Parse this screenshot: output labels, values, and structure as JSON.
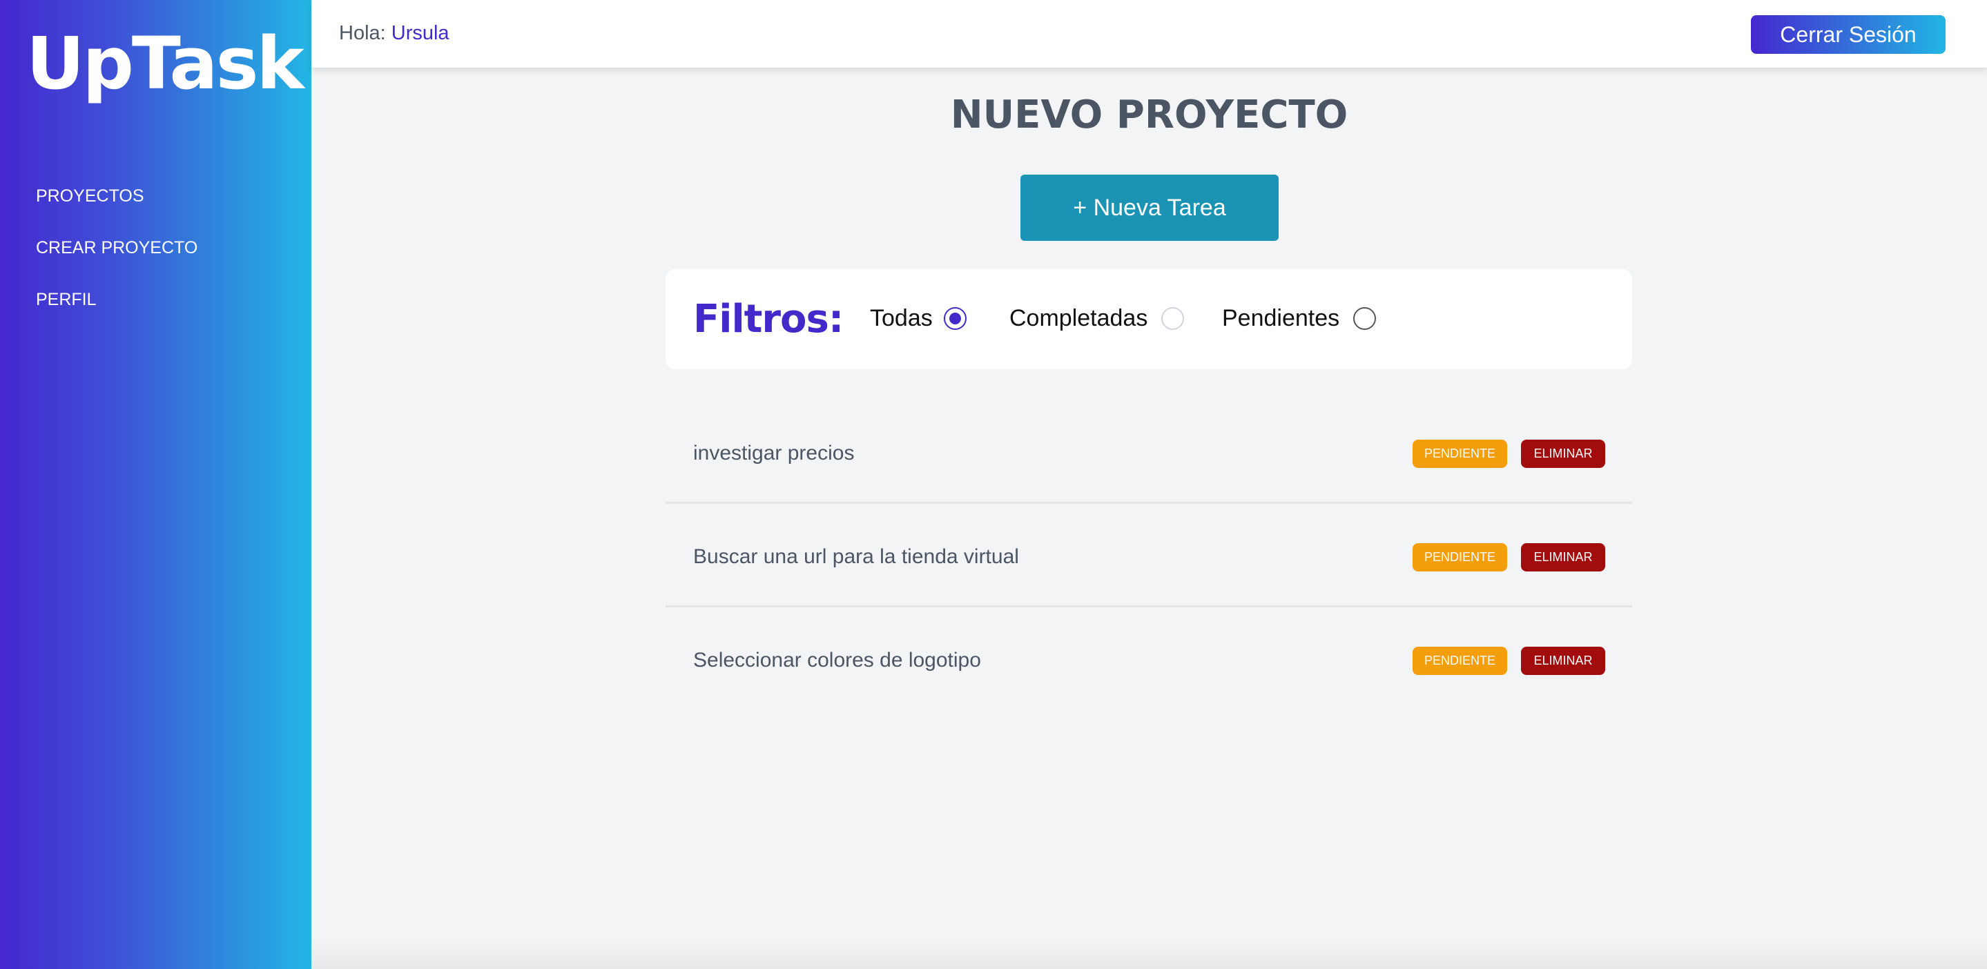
{
  "app": {
    "logo": "UpTask"
  },
  "sidebar": {
    "items": [
      {
        "label": "PROYECTOS"
      },
      {
        "label": "CREAR PROYECTO"
      },
      {
        "label": "PERFIL"
      }
    ]
  },
  "header": {
    "greeting": "Hola:",
    "user": "Ursula",
    "logout_label": "Cerrar Sesión"
  },
  "main": {
    "title": "NUEVO PROYECTO",
    "new_task_label": "+ Nueva Tarea",
    "filters": {
      "title": "Filtros:",
      "options": [
        {
          "label": "Todas",
          "selected": true
        },
        {
          "label": "Completadas",
          "selected": false
        },
        {
          "label": "Pendientes",
          "selected": false
        }
      ]
    },
    "tasks": [
      {
        "name": "investigar precios",
        "status": "PENDIENTE",
        "delete_label": "ELIMINAR"
      },
      {
        "name": "Buscar una url para la tienda virtual",
        "status": "PENDIENTE",
        "delete_label": "ELIMINAR"
      },
      {
        "name": "Seleccionar colores de logotipo",
        "status": "PENDIENTE",
        "delete_label": "ELIMINAR"
      }
    ]
  },
  "colors": {
    "accent": "#4329c9",
    "sidebar_gradient_start": "#4527cf",
    "sidebar_gradient_end": "#22b6e4",
    "new_task_button": "#1a93b5",
    "pending_badge": "#f59e0b",
    "delete_badge": "#a30c0c"
  },
  "icons": [
    "radio-checked-icon",
    "radio-empty-icon"
  ]
}
